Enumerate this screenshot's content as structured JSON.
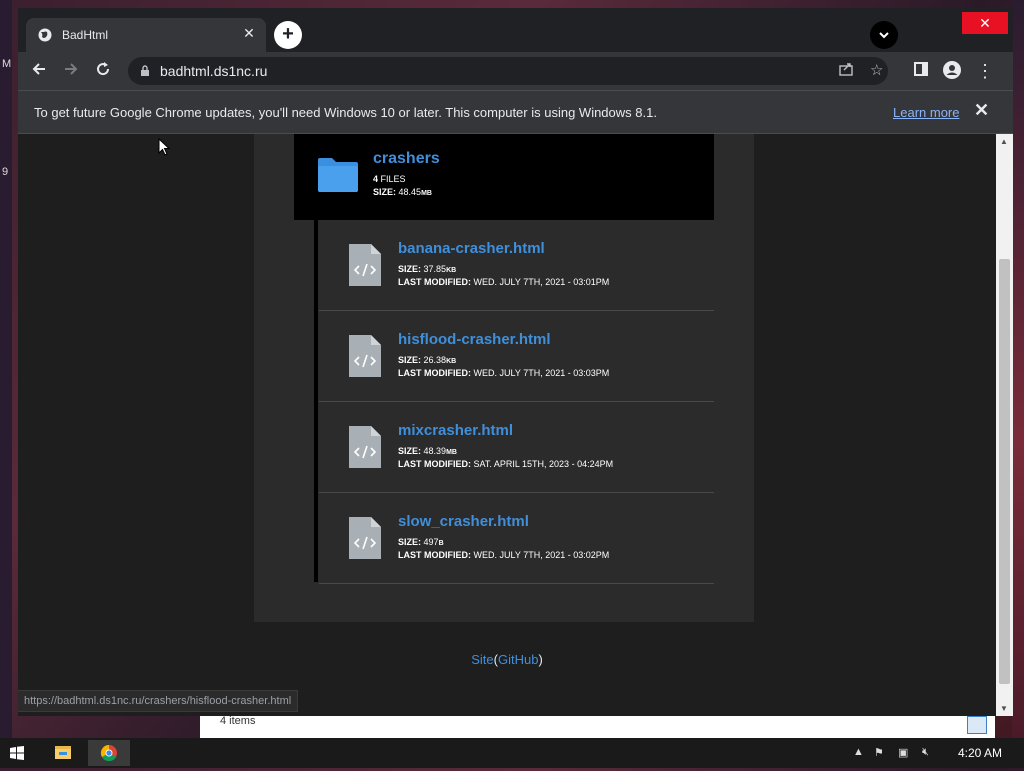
{
  "desktop": {
    "left_chars": [
      "M",
      "9"
    ]
  },
  "explorer": {
    "item_count": "4 items"
  },
  "tab": {
    "title": "BadHtml"
  },
  "omnibox": {
    "url": "badhtml.ds1nc.ru"
  },
  "infobar": {
    "message": "To get future Google Chrome updates, you'll need Windows 10 or later. This computer is using Windows 8.1.",
    "learn_more": "Learn more"
  },
  "folder": {
    "name": "crashers",
    "files_count": "4",
    "files_label": "FILES",
    "size_label": "SIZE:",
    "size_value": "48.45",
    "size_unit": "MB"
  },
  "files": [
    {
      "name": "banana-crasher.html",
      "size": "37.85",
      "unit": "KB",
      "modified": "WED. JULY 7TH, 2021 - 03:01PM"
    },
    {
      "name": "hisflood-crasher.html",
      "size": "26.38",
      "unit": "KB",
      "modified": "WED. JULY 7TH, 2021 - 03:03PM"
    },
    {
      "name": "mixcrasher.html",
      "size": "48.39",
      "unit": "MB",
      "modified": "SAT. APRIL 15TH, 2023 - 04:24PM"
    },
    {
      "name": "slow_crasher.html",
      "size": "497",
      "unit": "B",
      "modified": "WED. JULY 7TH, 2021 - 03:02PM"
    }
  ],
  "labels": {
    "size": "SIZE:",
    "last_modified": "LAST MODIFIED:"
  },
  "footer": {
    "site": "Site",
    "open": "(",
    "github": "GitHub",
    "close": ")"
  },
  "status_url": "https://badhtml.ds1nc.ru/crashers/hisflood-crasher.html",
  "taskbar": {
    "clock": "4:20 AM"
  },
  "colors": {
    "link": "#3f8fdb",
    "folder": "#3b8fe0",
    "file_icon": "#a9b0b5"
  },
  "icons": [
    "globe-icon",
    "close-icon",
    "plus-icon",
    "chevron-down-icon",
    "back-icon",
    "forward-icon",
    "reload-icon",
    "lock-icon",
    "share-icon",
    "star-icon",
    "sidepanel-icon",
    "profile-icon",
    "menu-icon",
    "folder-icon",
    "code-file-icon",
    "windows-start-icon",
    "file-explorer-icon",
    "chrome-icon"
  ]
}
